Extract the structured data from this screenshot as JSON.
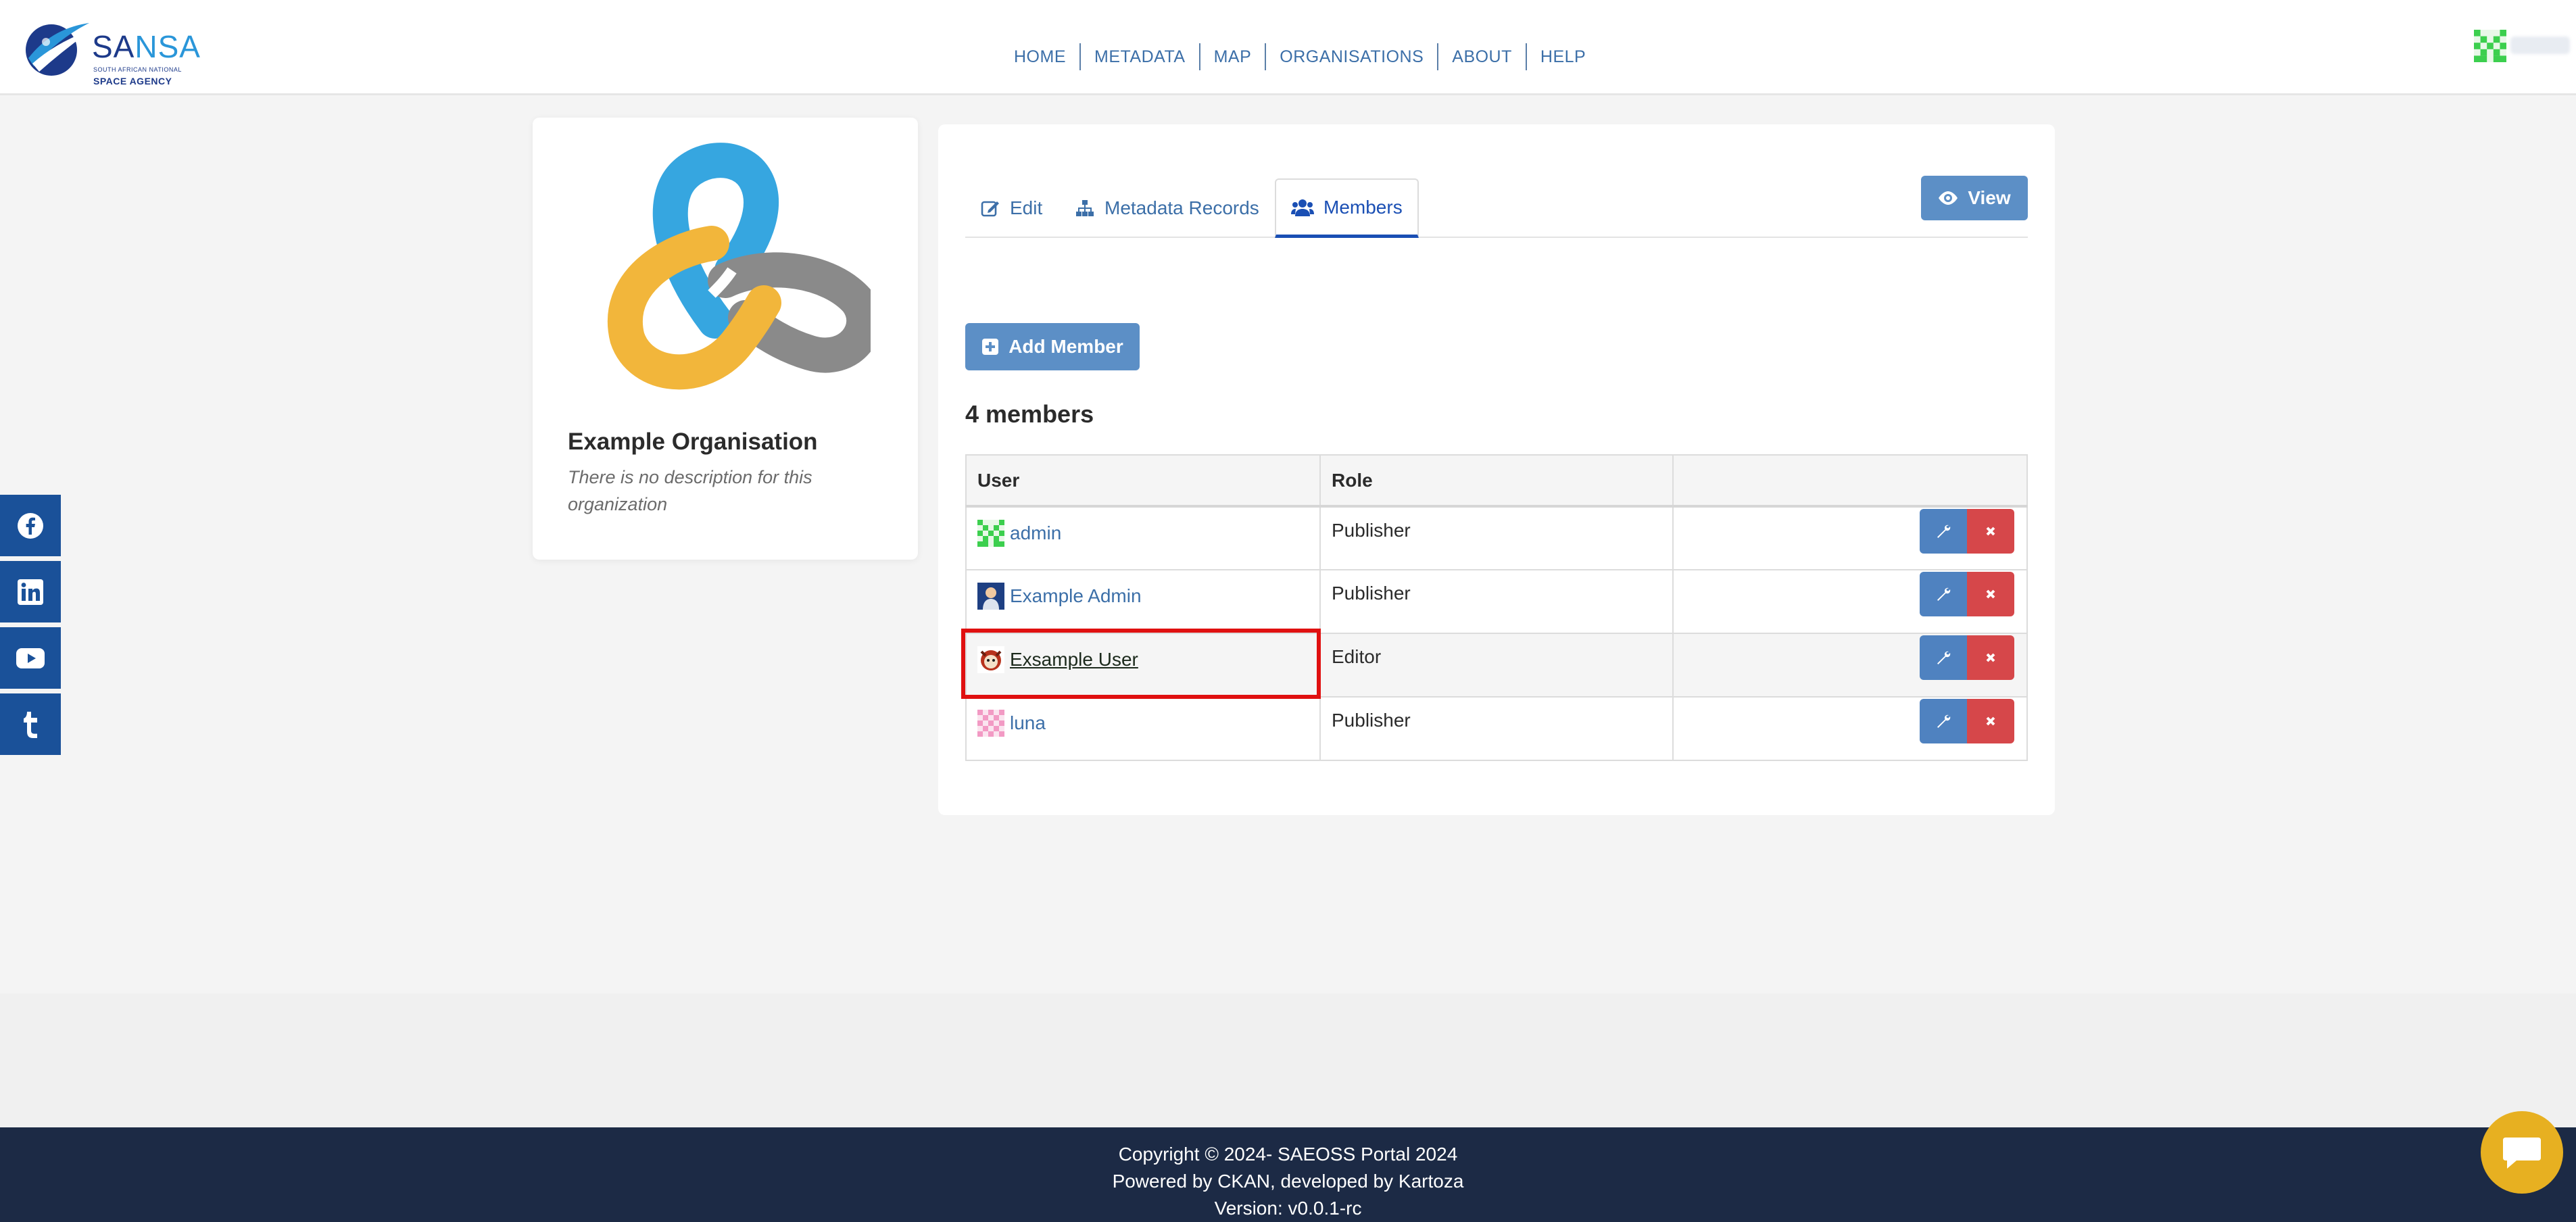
{
  "brand": {
    "logo_main_a": "SA",
    "logo_main_b": "NSA",
    "logo_line1": "SOUTH AFRICAN NATIONAL",
    "logo_line2": "SPACE AGENCY"
  },
  "nav": {
    "items": [
      "HOME",
      "METADATA",
      "MAP",
      "ORGANISATIONS",
      "ABOUT",
      "HELP"
    ]
  },
  "social": {
    "items": [
      "facebook-icon",
      "linkedin-icon",
      "youtube-icon",
      "tumblr-icon"
    ]
  },
  "organization": {
    "title": "Example Organisation",
    "description": "There is no description for this organization"
  },
  "tabs": [
    {
      "label": "Edit",
      "icon": "edit-icon"
    },
    {
      "label": "Metadata Records",
      "icon": "sitemap-icon"
    },
    {
      "label": "Members",
      "icon": "users-icon",
      "active": true
    }
  ],
  "view_button": {
    "label": "View",
    "icon": "eye-icon"
  },
  "add_member_button": {
    "label": "Add Member",
    "icon": "plus-square-icon"
  },
  "members_count": "4 members",
  "table": {
    "headers": [
      "User",
      "Role",
      ""
    ],
    "rows": [
      {
        "user": "admin",
        "role": "Publisher"
      },
      {
        "user": "Example Admin",
        "role": "Publisher"
      },
      {
        "user": "Exsample User",
        "role": "Editor",
        "highlighted": true
      },
      {
        "user": "luna",
        "role": "Publisher"
      }
    ]
  },
  "footer": {
    "line1": "Copyright © 2024- SAEOSS Portal 2024",
    "line2": "Powered by CKAN, developed by Kartoza",
    "line3": "Version: v0.0.1-rc"
  },
  "colors": {
    "primary_blue": "#5c8fc6",
    "link_blue": "#3c6fa8",
    "danger_red": "#d6474a",
    "footer_bg": "#1c2a45",
    "highlight_red": "#e01010",
    "chat_yellow": "#e7b021"
  }
}
